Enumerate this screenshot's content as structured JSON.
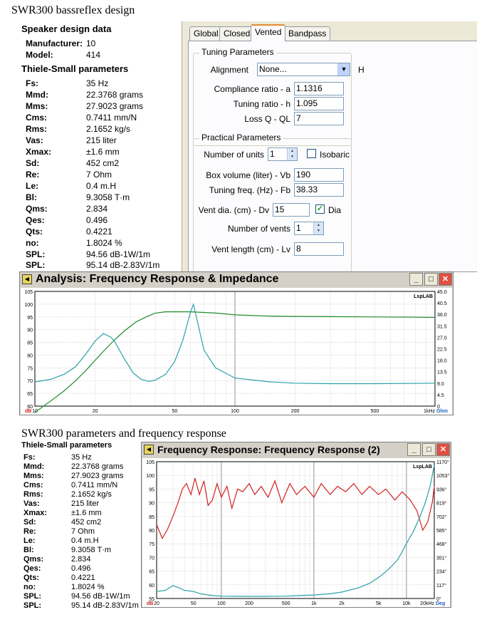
{
  "top": {
    "title": "SWR300 bassreflex design",
    "speaker_heading": "Speaker design data",
    "manufacturer_label": "Manufacturer:",
    "manufacturer_value": "10",
    "model_label": "Model:",
    "model_value": "414",
    "ts_heading": "Thiele-Small parameters"
  },
  "params": [
    {
      "label": "Fs:",
      "value": "35 Hz"
    },
    {
      "label": "Mmd:",
      "value": "22.3768 grams"
    },
    {
      "label": "Mms:",
      "value": "27.9023 grams"
    },
    {
      "label": "Cms:",
      "value": "0.7411 mm/N"
    },
    {
      "label": "Rms:",
      "value": "2.1652 kg/s"
    },
    {
      "label": "Vas:",
      "value": "215 liter"
    },
    {
      "label": "Xmax:",
      "value": "±1.6 mm"
    },
    {
      "label": "Sd:",
      "value": "452 cm2"
    },
    {
      "label": "Re:",
      "value": "7 Ohm"
    },
    {
      "label": "Le:",
      "value": "0.4 m.H"
    },
    {
      "label": "Bl:",
      "value": "9.3058 T·m"
    },
    {
      "label": "Qms:",
      "value": "2.834"
    },
    {
      "label": "Qes:",
      "value": "0.496"
    },
    {
      "label": "Qts:",
      "value": "0.4221"
    },
    {
      "label": "no:",
      "value": "1.8024 %"
    },
    {
      "label": "SPL:",
      "value": "94.56 dB-1W/1m"
    },
    {
      "label": "SPL:",
      "value": "95.14 dB-2.83V/1m"
    }
  ],
  "dialog": {
    "tabs": [
      {
        "label": "Global"
      },
      {
        "label": "Closed"
      },
      {
        "label": "Vented"
      },
      {
        "label": "Bandpass"
      }
    ],
    "active_tab": "Vented",
    "tuning": {
      "legend": "Tuning Parameters",
      "alignment_label": "Alignment",
      "alignment_value": "None...",
      "side_letter": "H",
      "compliance_label": "Compliance ratio - a",
      "compliance_value": "1.1316",
      "tuning_ratio_label": "Tuning ratio - h",
      "tuning_ratio_value": "1.095",
      "lossq_label": "Loss Q - QL",
      "lossq_value": "7"
    },
    "practical": {
      "legend": "Practical Parameters",
      "units_label": "Number of units",
      "units_value": "1",
      "isobaric_label": "Isobaric",
      "isobaric_checked": false,
      "box_label": "Box volume (liter) - Vb",
      "box_value": "190",
      "fb_label": "Tuning freq. (Hz) - Fb",
      "fb_value": "38.33",
      "vent_dia_label": "Vent dia. (cm) - Dv",
      "vent_dia_value": "15",
      "dia_label": "Dia",
      "dia_checked": true,
      "vents_label": "Number of vents",
      "vents_value": "1",
      "vent_len_label": "Vent length (cm) - Lv",
      "vent_len_value": "8"
    }
  },
  "analysis_window": {
    "title": "Analysis: Frequency Response & Impedance",
    "brand": "LspLAB"
  },
  "bottom": {
    "title": "SWR300 parameters and frequency response",
    "ts_heading": "Thiele-Small parameters"
  },
  "fr_window": {
    "title": "Frequency Response: Frequency Response (2)",
    "brand": "LspLAB"
  },
  "colors": {
    "impedance": "#2aa0a8",
    "spl": "#1e8a2a",
    "measured": "#d42020",
    "phase": "#2aa0a8",
    "grid": "#c8c8c8"
  },
  "chart_data": [
    {
      "type": "line",
      "x_scale": "log",
      "xlim": [
        10,
        1000
      ],
      "x_ticks": [
        "10",
        "20",
        "50",
        "100",
        "200",
        "500",
        "1kHz"
      ],
      "x_tick_values": [
        10,
        20,
        50,
        100,
        200,
        500,
        1000
      ],
      "x_unit": "dB",
      "ylim": [
        60,
        105
      ],
      "y_ticks": [
        "60",
        "65",
        "70",
        "75",
        "80",
        "85",
        "90",
        "95",
        "100",
        "105"
      ],
      "y2lim": [
        0,
        45
      ],
      "y2_ticks": [
        "0",
        "4.5",
        "9.0",
        "13.5",
        "18.0",
        "22.5",
        "27.0",
        "31.5",
        "36.0",
        "40.5",
        "45.0"
      ],
      "y2_unit": "Ohm",
      "grid": true,
      "series": [
        {
          "axis": "left",
          "x": [
            10,
            12,
            14,
            16,
            18,
            20,
            22,
            25,
            28,
            32,
            36,
            40,
            45,
            50,
            60,
            80,
            100,
            150,
            200,
            300,
            500,
            800,
            1000
          ],
          "y": [
            57.5,
            62,
            66,
            70,
            74,
            78,
            81.5,
            86,
            89.5,
            93,
            95,
            96.5,
            97,
            97,
            97,
            96.5,
            95.8,
            95.3,
            95.2,
            95.1,
            95.0,
            94.9,
            94.8
          ]
        },
        {
          "axis": "right",
          "x": [
            10,
            12,
            14,
            16,
            18,
            20,
            22,
            24,
            25,
            28,
            31,
            34,
            37,
            40,
            45,
            50,
            55,
            60,
            62,
            65,
            70,
            80,
            100,
            150,
            200,
            300,
            500,
            1000
          ],
          "y": [
            9.5,
            10.5,
            12.5,
            15.5,
            20.5,
            25.5,
            28.5,
            27,
            25.5,
            18.5,
            13,
            10.5,
            9.7,
            10.2,
            12.5,
            17.5,
            26,
            37,
            40,
            33,
            22,
            15,
            11,
            9.5,
            9,
            8.8,
            8.8,
            9.0
          ]
        }
      ]
    },
    {
      "type": "line",
      "x_scale": "log",
      "xlim": [
        20,
        20000
      ],
      "x_ticks": [
        "20",
        "50",
        "100",
        "200",
        "500",
        "1k",
        "2k",
        "5k",
        "10k",
        "20kHz"
      ],
      "x_tick_values": [
        20,
        50,
        100,
        200,
        500,
        1000,
        2000,
        5000,
        10000,
        20000
      ],
      "x_unit": "dB",
      "ylim": [
        55,
        105
      ],
      "y_ticks": [
        "55",
        "60",
        "65",
        "70",
        "75",
        "80",
        "85",
        "90",
        "95",
        "100",
        "105"
      ],
      "y2lim": [
        0,
        1170
      ],
      "y2_ticks": [
        "0°",
        "117°",
        "234°",
        "351°",
        "468°",
        "585°",
        "702°",
        "819°",
        "936°",
        "1053°",
        "1170°"
      ],
      "y2_unit": "Deg",
      "grid": true,
      "series": [
        {
          "axis": "left",
          "x": [
            20,
            23,
            26,
            30,
            34,
            38,
            42,
            47,
            52,
            58,
            65,
            72,
            80,
            90,
            100,
            115,
            130,
            150,
            170,
            200,
            230,
            270,
            320,
            380,
            450,
            550,
            650,
            800,
            1000,
            1200,
            1500,
            1800,
            2200,
            2700,
            3300,
            4000,
            5000,
            6000,
            7500,
            9000,
            11000,
            13000,
            15000,
            17000,
            19000,
            20000
          ],
          "y": [
            82,
            77,
            80,
            85,
            90,
            95,
            97,
            93,
            99,
            93,
            98,
            89,
            91,
            97,
            92,
            96,
            88,
            95,
            94,
            97,
            93,
            96,
            92,
            98,
            90,
            97,
            93,
            96,
            92,
            97,
            93,
            96,
            94,
            97,
            93,
            96,
            93,
            95,
            91,
            94,
            91,
            87,
            80,
            83,
            90,
            96
          ]
        },
        {
          "axis": "right",
          "x": [
            20,
            25,
            30,
            35,
            40,
            50,
            60,
            80,
            100,
            150,
            200,
            300,
            500,
            700,
            1000,
            1500,
            2000,
            3000,
            4000,
            5000,
            6000,
            7000,
            8000,
            9000,
            10000,
            12000,
            14000,
            16000,
            18000,
            20000
          ],
          "y": [
            60,
            70,
            110,
            90,
            70,
            60,
            40,
            25,
            20,
            18,
            18,
            18,
            20,
            25,
            30,
            40,
            55,
            90,
            130,
            180,
            230,
            280,
            330,
            400,
            470,
            580,
            700,
            820,
            960,
            1140
          ]
        }
      ]
    }
  ]
}
